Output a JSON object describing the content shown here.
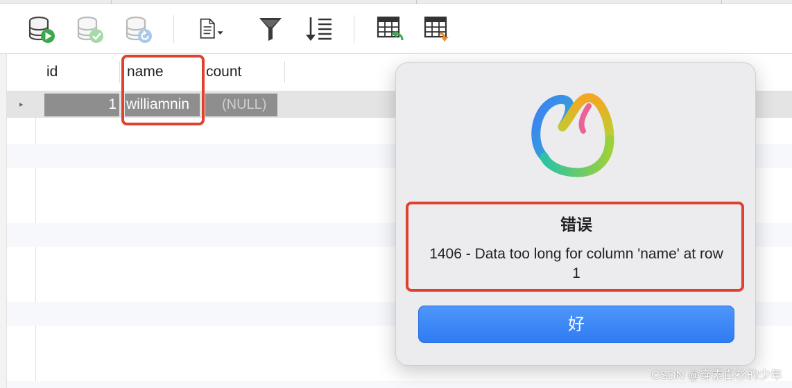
{
  "grid": {
    "columns": [
      "id",
      "name",
      "count"
    ],
    "rows": [
      {
        "marker": "▸",
        "id": "1",
        "name": "williamnin",
        "count": "(NULL)"
      }
    ]
  },
  "toolbar": {
    "icons": [
      "db-run-icon",
      "db-commit-icon",
      "db-revert-icon",
      "document-dropdown-icon",
      "filter-icon",
      "sort-icon",
      "import-table-icon",
      "export-table-icon"
    ]
  },
  "dialog": {
    "title": "错误",
    "message": "1406 - Data too long for column 'name' at row 1",
    "ok_label": "好"
  },
  "watermark": "CSDN @穿素白衫的少年",
  "colors": {
    "highlight_border": "#e0412f",
    "ok_button": "#3b84f6",
    "selected_cell": "#8e8e8e"
  }
}
